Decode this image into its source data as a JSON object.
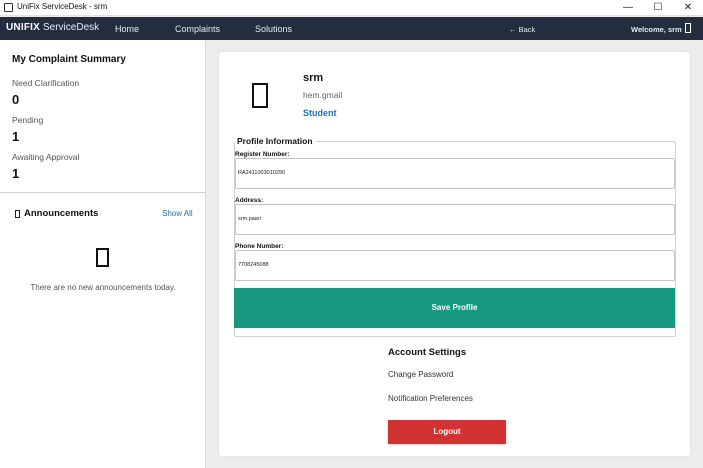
{
  "window": {
    "title": "UniFix ServiceDesk - srm",
    "minimize_glyph": "—",
    "maximize_glyph": "☐",
    "close_glyph": "✕",
    "app_icon": "window-icon"
  },
  "navbar": {
    "brand": "UNIFIX",
    "brand_sub": "ServiceDesk",
    "links": [
      "Home",
      "Complaints",
      "Solutions"
    ],
    "back": "← Back",
    "welcome": "Welcome, srm",
    "user_icon": "user-icon",
    "colors": {
      "background": "#242d3f",
      "text": "#ffffff"
    }
  },
  "sidebar": {
    "summary_title": "My Complaint Summary",
    "stats": [
      {
        "label": "Need Clarification",
        "value": "0"
      },
      {
        "label": "Pending",
        "value": "1"
      },
      {
        "label": "Awaiting Approval",
        "value": "1"
      }
    ],
    "announcements": {
      "icon": "megaphone-icon",
      "title": "Announcements",
      "show_all": "Show All",
      "empty_icon": "empty-box-icon",
      "empty_text": "There are no new announcements today."
    }
  },
  "profile": {
    "avatar_icon": "avatar-icon",
    "name": "srm",
    "email": "hem.gmail",
    "role": "Student",
    "section_title": "Profile Information",
    "fields": [
      {
        "label": "Register Number:",
        "value": "RA2411003010290"
      },
      {
        "label": "Address:",
        "value": "srm.paari"
      },
      {
        "label": "Phone Number:",
        "value": "7708245088"
      }
    ],
    "save_label": "Save Profile",
    "colors": {
      "accent": "#1f6fb0",
      "save": "#16997f"
    }
  },
  "account": {
    "title": "Account Settings",
    "change_password": "Change Password",
    "notification_preferences": "Notification Preferences",
    "logout": "Logout",
    "colors": {
      "logout": "#d23232"
    }
  }
}
